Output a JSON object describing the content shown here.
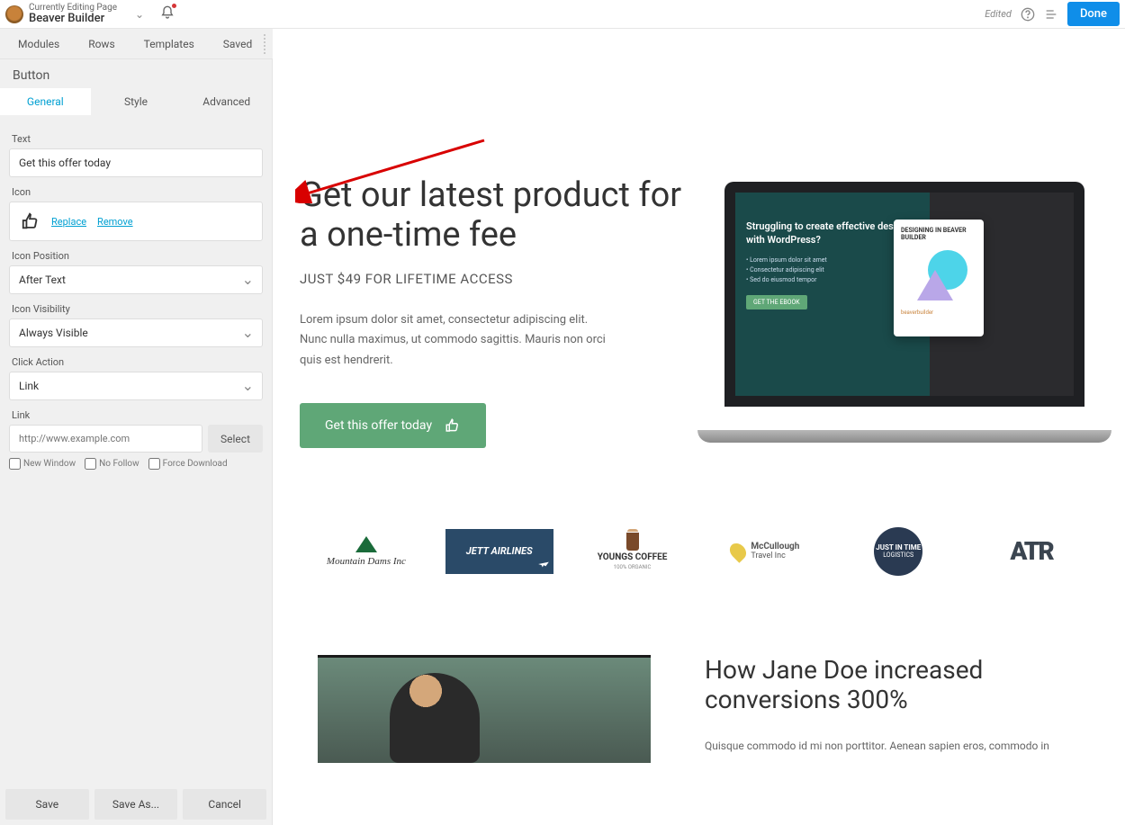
{
  "topbar": {
    "editing_label": "Currently Editing Page",
    "page_title": "Beaver Builder",
    "edited": "Edited",
    "done": "Done"
  },
  "tabbar": {
    "t1": "Modules",
    "t2": "Rows",
    "t3": "Templates",
    "t4": "Saved"
  },
  "module": {
    "title": "Button"
  },
  "subtabs": {
    "s1": "General",
    "s2": "Style",
    "s3": "Advanced"
  },
  "fields": {
    "text_label": "Text",
    "text_value": "Get this offer today",
    "icon_label": "Icon",
    "replace": "Replace",
    "remove": "Remove",
    "icon_pos_label": "Icon Position",
    "icon_pos_value": "After Text",
    "icon_vis_label": "Icon Visibility",
    "icon_vis_value": "Always Visible",
    "click_label": "Click Action",
    "click_value": "Link",
    "link_label": "Link",
    "link_placeholder": "http://www.example.com",
    "select_btn": "Select",
    "new_window": "New Window",
    "no_follow": "No Follow",
    "force_dl": "Force Download"
  },
  "footer": {
    "save": "Save",
    "saveas": "Save As...",
    "cancel": "Cancel"
  },
  "hero": {
    "heading": "Get our latest product for a one-time fee",
    "subheading": "JUST $49 FOR LIFETIME ACCESS",
    "body": "Lorem ipsum dolor sit amet, consectetur adipiscing elit. Nunc nulla maximus, ut commodo sagittis. Mauris non orci quis est hendrerit.",
    "cta": "Get this offer today"
  },
  "screen": {
    "heading": "Struggling to create effective designs with WordPress?",
    "card_title": "DESIGNING IN BEAVER BUILDER",
    "bblogo": "beaverbuilder"
  },
  "logos": {
    "l1": "Mountain Dams Inc",
    "l2": "JETT AIRLINES",
    "l3a": "YOUNGS COFFEE",
    "l3b": "100% ORGANIC",
    "l4a": "McCullough",
    "l4b": "Travel Inc",
    "l5a": "JUST IN TIME",
    "l5b": "LOGISTICS",
    "l6": "ATR"
  },
  "story": {
    "heading": "How Jane Doe increased conversions 300%",
    "body": "Quisque commodo id mi non porttitor. Aenean sapien eros, commodo in"
  }
}
